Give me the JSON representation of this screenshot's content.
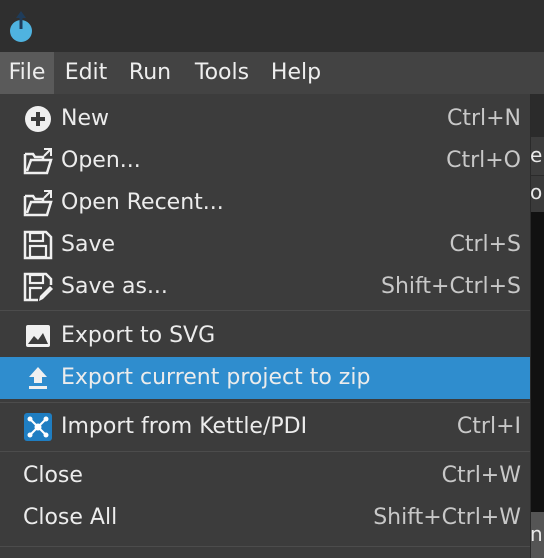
{
  "menubar": {
    "items": [
      {
        "label": "File"
      },
      {
        "label": "Edit"
      },
      {
        "label": "Run"
      },
      {
        "label": "Tools"
      },
      {
        "label": "Help"
      }
    ]
  },
  "file_menu": {
    "items": [
      {
        "label": "New",
        "shortcut": "Ctrl+N",
        "icon": "new-plus-icon"
      },
      {
        "label": "Open...",
        "shortcut": "Ctrl+O",
        "icon": "folder-open-icon"
      },
      {
        "label": "Open Recent...",
        "shortcut": "",
        "icon": "folder-open-icon"
      },
      {
        "label": "Save",
        "shortcut": "Ctrl+S",
        "icon": "save-icon"
      },
      {
        "label": "Save as...",
        "shortcut": "Shift+Ctrl+S",
        "icon": "save-as-icon"
      },
      {
        "label": "Export to SVG",
        "shortcut": "",
        "icon": "image-icon"
      },
      {
        "label": "Export current project to zip",
        "shortcut": "",
        "icon": "upload-icon",
        "highlighted": true
      },
      {
        "label": "Import from Kettle/PDI",
        "shortcut": "Ctrl+I",
        "icon": "kettle-icon"
      },
      {
        "label": "Close",
        "shortcut": "Ctrl+W"
      },
      {
        "label": "Close All",
        "shortcut": "Shift+Ctrl+W"
      }
    ]
  },
  "background_text": {
    "line1": "ep",
    "line2": "o",
    "line3": "np"
  },
  "colors": {
    "highlight": "#2f8dce",
    "logo": "#4fb3e0"
  }
}
